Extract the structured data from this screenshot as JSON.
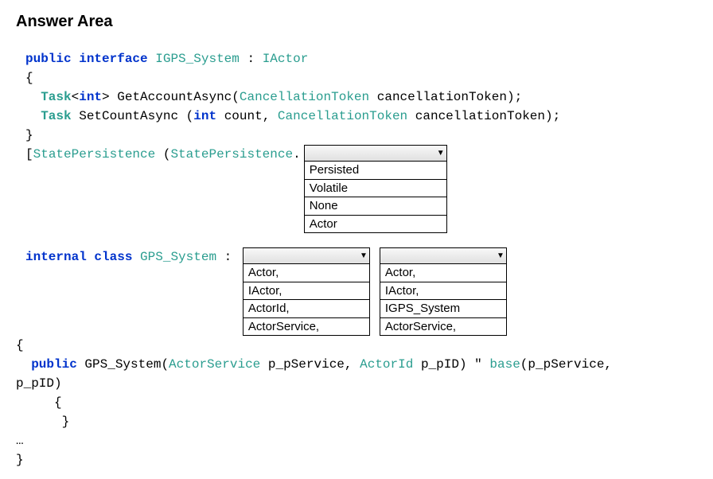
{
  "title": "Answer Area",
  "code": {
    "kw_public": "public",
    "kw_interface": "interface",
    "kw_internal": "internal",
    "kw_class": "class",
    "kw_int": "int",
    "type_IGPS_System": "IGPS_System",
    "type_IActor": "IActor",
    "type_Task": "Task",
    "type_CancellationToken": "CancellationToken",
    "type_StatePersistence": "StatePersistence",
    "type_GPS_System": "GPS_System",
    "type_ActorService": "ActorService",
    "type_ActorId": "ActorId",
    "type_base": "base",
    "method_GetAccountAsync": "GetAccountAsync",
    "method_SetCountAsync": "SetCountAsync",
    "param_cancellationToken": "cancellationToken",
    "param_count": "count",
    "param_p_pService": "p_pService",
    "param_p_pID": "p_pID",
    "ellipsis": "…",
    "brace_open": "{",
    "brace_close": "}",
    "bracket_open": "[",
    "paren_open": "(",
    "paren_close": ")",
    "colon": ":",
    "dot": ".",
    "comma": ",",
    "semicolon": ";",
    "angle_open": "<",
    "angle_close": ">",
    "quote": "\""
  },
  "dropdown1": {
    "selected": "",
    "options": [
      "Persisted",
      "Volatile",
      "None",
      "Actor"
    ]
  },
  "dropdown2": {
    "selected": "",
    "options": [
      "Actor,",
      "IActor,",
      "ActorId,",
      "ActorService,"
    ]
  },
  "dropdown3": {
    "selected": "",
    "options": [
      "Actor,",
      "IActor,",
      "IGPS_System",
      "ActorService,"
    ]
  }
}
